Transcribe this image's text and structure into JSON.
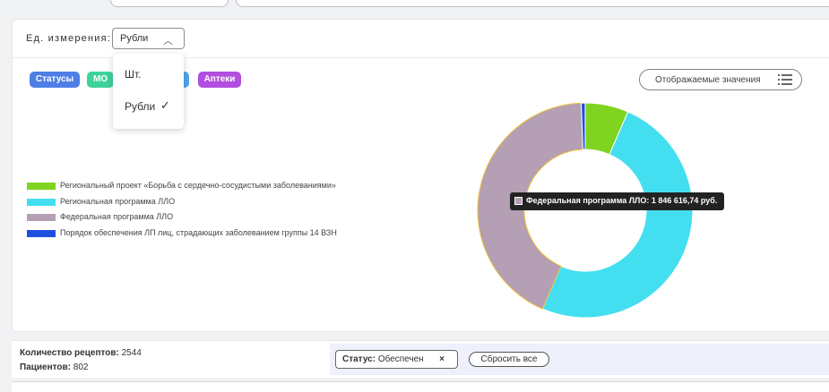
{
  "toolbar": {
    "unit_label": "Ед. измерения:",
    "unit_selected": "Рубли",
    "unit_options": [
      "Шт.",
      "Рубли"
    ]
  },
  "chips": [
    {
      "label": "Статусы",
      "color": "#4f7ee6"
    },
    {
      "label": "МО",
      "color": "#3dd29a"
    },
    {
      "label": "",
      "color": "#4fa6ee"
    },
    {
      "label": "Аптеки",
      "color": "#b24ee0"
    }
  ],
  "display_button": {
    "label": "Отображаемые значения",
    "icon": "list-settings-icon"
  },
  "chart_data": {
    "type": "donut",
    "series": [
      {
        "name": "Региональный проект «Борьба с сердечно-сосудистыми заболеваниями»",
        "color": "#7ed420",
        "value": 6.5
      },
      {
        "name": "Региональная программа ЛЛО",
        "color": "#43dff0",
        "value": 50.0
      },
      {
        "name": "Федеральная программа ЛЛО",
        "color": "#b49fb4",
        "value": 42.9
      },
      {
        "name": "Порядок обеспечения ЛП лиц, страдающих заболеванием группы 14 ВЗН",
        "color": "#1f4fe0",
        "value": 0.6
      }
    ],
    "tooltip": "Федеральная программа ЛЛО: 1 846 616,74 руб."
  },
  "footer": {
    "recipes_label": "Количество рецептов:",
    "recipes_value": "2544",
    "patients_label": "Пациентов:",
    "patients_value": "802",
    "filter_label": "Статус:",
    "filter_value": "Обеспечен",
    "filter_remove": "×",
    "reset_label": "Сбросить все"
  }
}
